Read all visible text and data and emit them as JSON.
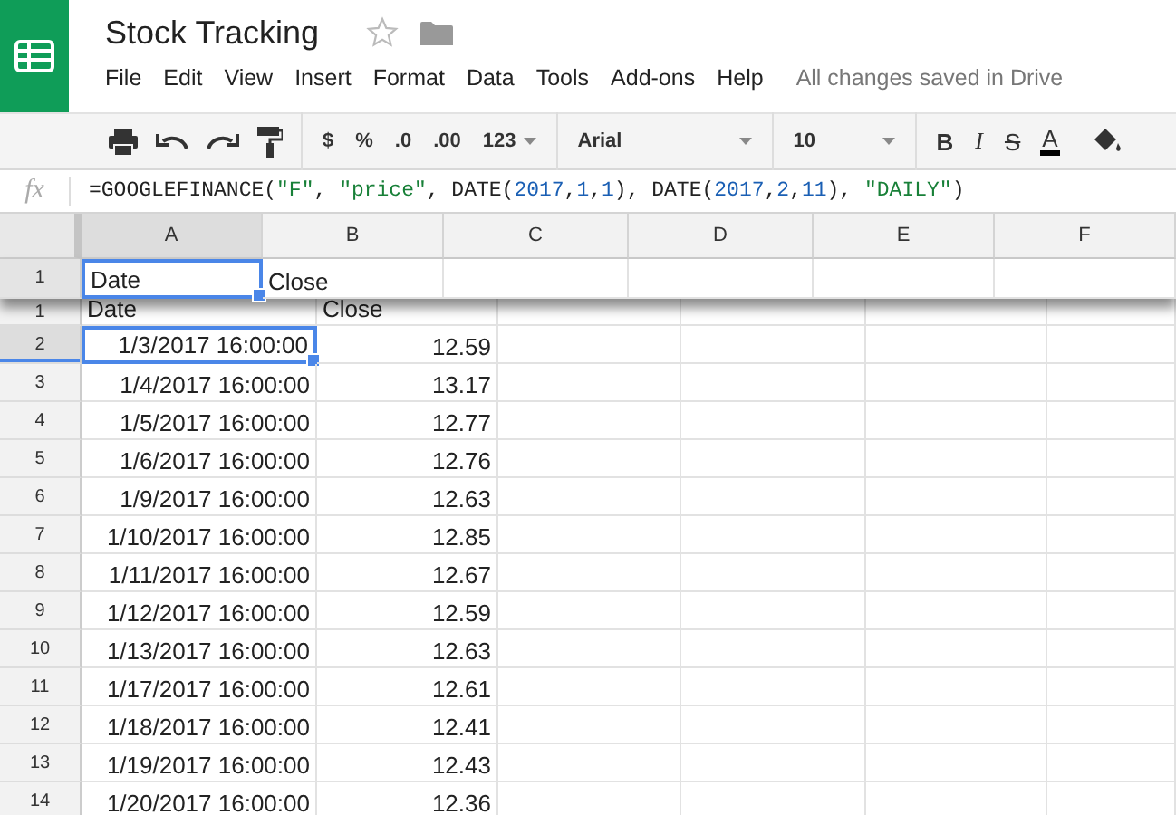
{
  "doc": {
    "title": "Stock Tracking",
    "starred": false,
    "menu": [
      "File",
      "Edit",
      "View",
      "Insert",
      "Format",
      "Data",
      "Tools",
      "Add-ons",
      "Help"
    ],
    "save_status": "All changes saved in Drive"
  },
  "toolbar": {
    "currency": "$",
    "percent": "%",
    "decrease_decimals": ".0",
    "increase_decimals": ".00",
    "number_format": "123",
    "font": "Arial",
    "font_size": "10",
    "bold": "B",
    "italic": "I",
    "strikethrough": "S",
    "text_color": "A"
  },
  "formula_bar": {
    "label": "fx",
    "tokens": [
      {
        "text": "=GOOGLEFINANCE(",
        "kind": "plain"
      },
      {
        "text": "\"F\"",
        "kind": "string"
      },
      {
        "text": ", ",
        "kind": "plain"
      },
      {
        "text": "\"price\"",
        "kind": "string"
      },
      {
        "text": ", DATE(",
        "kind": "plain"
      },
      {
        "text": "2017",
        "kind": "number"
      },
      {
        "text": ",",
        "kind": "plain"
      },
      {
        "text": "1",
        "kind": "number"
      },
      {
        "text": ",",
        "kind": "plain"
      },
      {
        "text": "1",
        "kind": "number"
      },
      {
        "text": "), DATE(",
        "kind": "plain"
      },
      {
        "text": "2017",
        "kind": "number"
      },
      {
        "text": ",",
        "kind": "plain"
      },
      {
        "text": "2",
        "kind": "number"
      },
      {
        "text": ",",
        "kind": "plain"
      },
      {
        "text": "11",
        "kind": "number"
      },
      {
        "text": "), ",
        "kind": "plain"
      },
      {
        "text": "\"DAILY\"",
        "kind": "string"
      },
      {
        "text": ")",
        "kind": "plain"
      }
    ]
  },
  "columns": [
    {
      "label": "A",
      "selected": true
    },
    {
      "label": "B",
      "selected": false
    },
    {
      "label": "C",
      "selected": false
    },
    {
      "label": "D",
      "selected": false
    },
    {
      "label": "E",
      "selected": false
    },
    {
      "label": "F",
      "selected": false
    }
  ],
  "frozen_row": {
    "number": "1",
    "cells": [
      {
        "text": "Date",
        "selected": true
      },
      {
        "text": "Close",
        "selected": false
      }
    ]
  },
  "rows": [
    {
      "number": "1",
      "kind": "header",
      "cells": [
        {
          "text": "Date",
          "selected": false
        },
        {
          "text": "Close",
          "selected": false
        }
      ]
    },
    {
      "number": "2",
      "kind": "data",
      "cells": [
        {
          "text": "1/3/2017 16:00:00",
          "selected": true
        },
        {
          "text": "12.59",
          "selected": false
        }
      ]
    },
    {
      "number": "3",
      "kind": "data",
      "cells": [
        {
          "text": "1/4/2017 16:00:00",
          "selected": false
        },
        {
          "text": "13.17",
          "selected": false
        }
      ]
    },
    {
      "number": "4",
      "kind": "data",
      "cells": [
        {
          "text": "1/5/2017 16:00:00",
          "selected": false
        },
        {
          "text": "12.77",
          "selected": false
        }
      ]
    },
    {
      "number": "5",
      "kind": "data",
      "cells": [
        {
          "text": "1/6/2017 16:00:00",
          "selected": false
        },
        {
          "text": "12.76",
          "selected": false
        }
      ]
    },
    {
      "number": "6",
      "kind": "data",
      "cells": [
        {
          "text": "1/9/2017 16:00:00",
          "selected": false
        },
        {
          "text": "12.63",
          "selected": false
        }
      ]
    },
    {
      "number": "7",
      "kind": "data",
      "cells": [
        {
          "text": "1/10/2017 16:00:00",
          "selected": false
        },
        {
          "text": "12.85",
          "selected": false
        }
      ]
    },
    {
      "number": "8",
      "kind": "data",
      "cells": [
        {
          "text": "1/11/2017 16:00:00",
          "selected": false
        },
        {
          "text": "12.67",
          "selected": false
        }
      ]
    },
    {
      "number": "9",
      "kind": "data",
      "cells": [
        {
          "text": "1/12/2017 16:00:00",
          "selected": false
        },
        {
          "text": "12.59",
          "selected": false
        }
      ]
    },
    {
      "number": "10",
      "kind": "data",
      "cells": [
        {
          "text": "1/13/2017 16:00:00",
          "selected": false
        },
        {
          "text": "12.63",
          "selected": false
        }
      ]
    },
    {
      "number": "11",
      "kind": "data",
      "cells": [
        {
          "text": "1/17/2017 16:00:00",
          "selected": false
        },
        {
          "text": "12.61",
          "selected": false
        }
      ]
    },
    {
      "number": "12",
      "kind": "data",
      "cells": [
        {
          "text": "1/18/2017 16:00:00",
          "selected": false
        },
        {
          "text": "12.41",
          "selected": false
        }
      ]
    },
    {
      "number": "13",
      "kind": "data",
      "cells": [
        {
          "text": "1/19/2017 16:00:00",
          "selected": false
        },
        {
          "text": "12.43",
          "selected": false
        }
      ]
    },
    {
      "number": "14",
      "kind": "data",
      "cells": [
        {
          "text": "1/20/2017 16:00:00",
          "selected": false
        },
        {
          "text": "12.36",
          "selected": false
        }
      ]
    }
  ]
}
